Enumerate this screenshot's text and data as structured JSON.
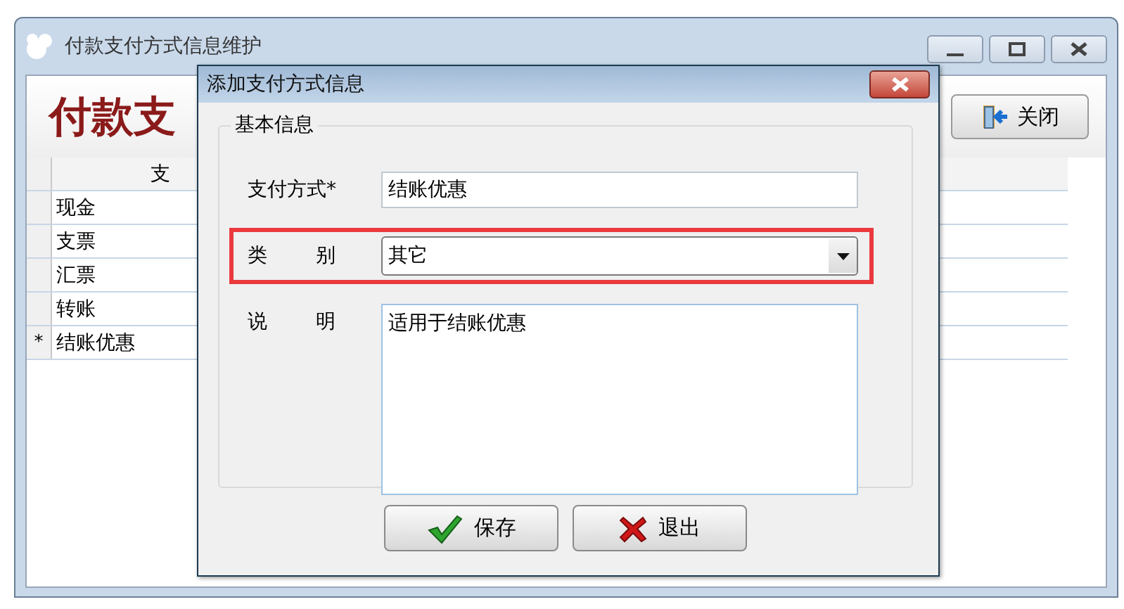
{
  "main_window": {
    "title": "付款支付方式信息维护",
    "heading": "付款支",
    "close_button": "关闭",
    "table": {
      "columns": [
        "支"
      ],
      "rows": [
        {
          "marker": "",
          "cells": [
            "现金"
          ]
        },
        {
          "marker": "",
          "cells": [
            "支票"
          ]
        },
        {
          "marker": "",
          "cells": [
            "汇票"
          ]
        },
        {
          "marker": "",
          "cells": [
            "转账"
          ]
        },
        {
          "marker": "*",
          "cells": [
            "结账优惠"
          ]
        }
      ]
    }
  },
  "dialog": {
    "title": "添加支付方式信息",
    "group_title": "基本信息",
    "fields": [
      {
        "kind": "text",
        "label": "支付方式*",
        "value": "结账优惠",
        "highlighted": false
      },
      {
        "kind": "select",
        "label": "类 别",
        "value": "其它",
        "highlighted": true
      },
      {
        "kind": "textarea",
        "label": "说 明",
        "value": "适用于结账优惠",
        "highlighted": false
      }
    ],
    "buttons": [
      {
        "kind": "save",
        "label": "保存"
      },
      {
        "kind": "exit",
        "label": "退出"
      }
    ]
  }
}
